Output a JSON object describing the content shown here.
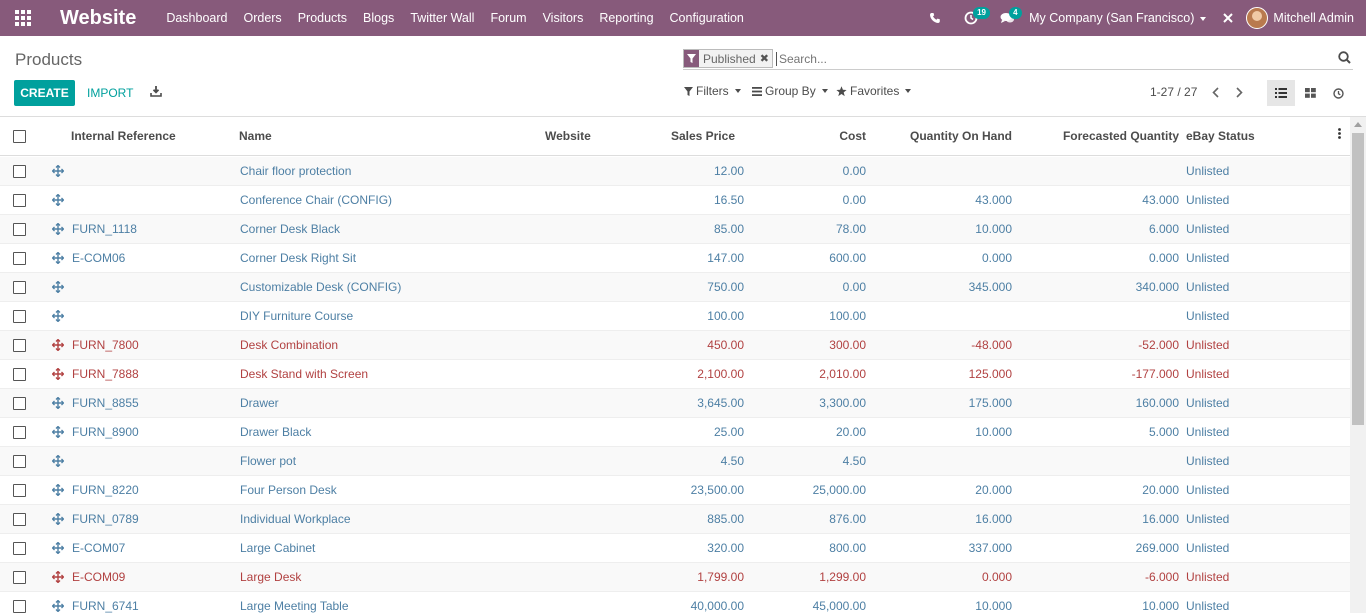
{
  "navbar": {
    "app_name": "Website",
    "menu": [
      "Dashboard",
      "Orders",
      "Products",
      "Blogs",
      "Twitter Wall",
      "Forum",
      "Visitors",
      "Reporting",
      "Configuration"
    ],
    "activity_count": "19",
    "messages_count": "4",
    "company": "My Company (San Francisco)",
    "user": "Mitchell Admin"
  },
  "control_panel": {
    "breadcrumb": "Products",
    "facet": "Published",
    "search_placeholder": "Search...",
    "create_label": "CREATE",
    "import_label": "IMPORT",
    "filters_label": "Filters",
    "groupby_label": "Group By",
    "favorites_label": "Favorites",
    "pager": "1-27 / 27"
  },
  "table": {
    "columns": [
      "Internal Reference",
      "Name",
      "Website",
      "Sales Price",
      "Cost",
      "Quantity On Hand",
      "Forecasted Quantity",
      "eBay Status"
    ],
    "rows": [
      {
        "ref": "",
        "name": "Chair floor protection",
        "price": "12.00",
        "cost": "0.00",
        "qty": "",
        "forecast": "",
        "ebay": "Unlisted",
        "red": false
      },
      {
        "ref": "",
        "name": "Conference Chair (CONFIG)",
        "price": "16.50",
        "cost": "0.00",
        "qty": "43.000",
        "forecast": "43.000",
        "ebay": "Unlisted",
        "red": false
      },
      {
        "ref": "FURN_1118",
        "name": "Corner Desk Black",
        "price": "85.00",
        "cost": "78.00",
        "qty": "10.000",
        "forecast": "6.000",
        "ebay": "Unlisted",
        "red": false
      },
      {
        "ref": "E-COM06",
        "name": "Corner Desk Right Sit",
        "price": "147.00",
        "cost": "600.00",
        "qty": "0.000",
        "forecast": "0.000",
        "ebay": "Unlisted",
        "red": false
      },
      {
        "ref": "",
        "name": "Customizable Desk (CONFIG)",
        "price": "750.00",
        "cost": "0.00",
        "qty": "345.000",
        "forecast": "340.000",
        "ebay": "Unlisted",
        "red": false
      },
      {
        "ref": "",
        "name": "DIY Furniture Course",
        "price": "100.00",
        "cost": "100.00",
        "qty": "",
        "forecast": "",
        "ebay": "Unlisted",
        "red": false
      },
      {
        "ref": "FURN_7800",
        "name": "Desk Combination",
        "price": "450.00",
        "cost": "300.00",
        "qty": "-48.000",
        "forecast": "-52.000",
        "ebay": "Unlisted",
        "red": true
      },
      {
        "ref": "FURN_7888",
        "name": "Desk Stand with Screen",
        "price": "2,100.00",
        "cost": "2,010.00",
        "qty": "125.000",
        "forecast": "-177.000",
        "ebay": "Unlisted",
        "red": true
      },
      {
        "ref": "FURN_8855",
        "name": "Drawer",
        "price": "3,645.00",
        "cost": "3,300.00",
        "qty": "175.000",
        "forecast": "160.000",
        "ebay": "Unlisted",
        "red": false
      },
      {
        "ref": "FURN_8900",
        "name": "Drawer Black",
        "price": "25.00",
        "cost": "20.00",
        "qty": "10.000",
        "forecast": "5.000",
        "ebay": "Unlisted",
        "red": false
      },
      {
        "ref": "",
        "name": "Flower pot",
        "price": "4.50",
        "cost": "4.50",
        "qty": "",
        "forecast": "",
        "ebay": "Unlisted",
        "red": false
      },
      {
        "ref": "FURN_8220",
        "name": "Four Person Desk",
        "price": "23,500.00",
        "cost": "25,000.00",
        "qty": "20.000",
        "forecast": "20.000",
        "ebay": "Unlisted",
        "red": false
      },
      {
        "ref": "FURN_0789",
        "name": "Individual Workplace",
        "price": "885.00",
        "cost": "876.00",
        "qty": "16.000",
        "forecast": "16.000",
        "ebay": "Unlisted",
        "red": false
      },
      {
        "ref": "E-COM07",
        "name": "Large Cabinet",
        "price": "320.00",
        "cost": "800.00",
        "qty": "337.000",
        "forecast": "269.000",
        "ebay": "Unlisted",
        "red": false
      },
      {
        "ref": "E-COM09",
        "name": "Large Desk",
        "price": "1,799.00",
        "cost": "1,299.00",
        "qty": "0.000",
        "forecast": "-6.000",
        "ebay": "Unlisted",
        "red": true
      },
      {
        "ref": "FURN_6741",
        "name": "Large Meeting Table",
        "price": "40,000.00",
        "cost": "45,000.00",
        "qty": "10.000",
        "forecast": "10.000",
        "ebay": "Unlisted",
        "red": false
      }
    ]
  },
  "colors": {
    "brand": "#875a7b",
    "accent": "#00a09d",
    "link": "#4d7fa4",
    "danger": "#b14141"
  },
  "icons": {
    "apps": "apps-grid-icon",
    "phone": "phone-icon",
    "activity": "clock-icon",
    "messages": "chat-icon",
    "debug": "bug-icon",
    "download": "download-icon",
    "filter": "funnel-icon",
    "groupby": "bars-icon",
    "favorites": "star-icon",
    "list_view": "list-icon",
    "kanban_view": "kanban-icon",
    "activity_view": "clock-icon",
    "row_handle": "arrows-move-icon"
  }
}
